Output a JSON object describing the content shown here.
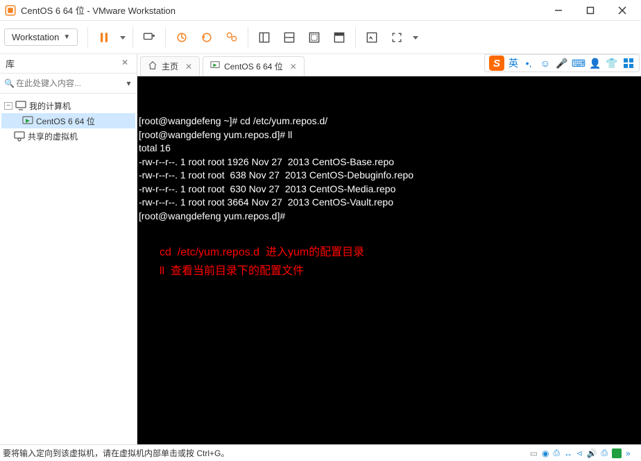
{
  "titlebar": {
    "title": "CentOS 6 64 位 - VMware Workstation"
  },
  "toolbar": {
    "menu_label": "Workstation"
  },
  "sidebar": {
    "title": "库",
    "search_placeholder": "在此处键入内容...",
    "root": {
      "label": "我的计算机"
    },
    "vm": {
      "label": "CentOS 6 64 位"
    },
    "shared": {
      "label": "共享的虚拟机"
    }
  },
  "tabs": {
    "home": "主页",
    "vm": "CentOS 6 64 位"
  },
  "terminal": {
    "lines": [
      "[root@wangdefeng ~]# cd /etc/yum.repos.d/",
      "[root@wangdefeng yum.repos.d]# ll",
      "total 16",
      "-rw-r--r--. 1 root root 1926 Nov 27  2013 CentOS-Base.repo",
      "-rw-r--r--. 1 root root  638 Nov 27  2013 CentOS-Debuginfo.repo",
      "-rw-r--r--. 1 root root  630 Nov 27  2013 CentOS-Media.repo",
      "-rw-r--r--. 1 root root 3664 Nov 27  2013 CentOS-Vault.repo",
      "[root@wangdefeng yum.repos.d]# "
    ],
    "annotation_line1": "cd  /etc/yum.repos.d  进入yum的配置目录",
    "annotation_line2": "ll  查看当前目录下的配置文件"
  },
  "ime": {
    "lang": "英"
  },
  "statusbar": {
    "message": "要将输入定向到该虚拟机，请在虚拟机内部单击或按 Ctrl+G。"
  },
  "colors": {
    "accent": "#f58220",
    "link": "#1a87d6"
  }
}
